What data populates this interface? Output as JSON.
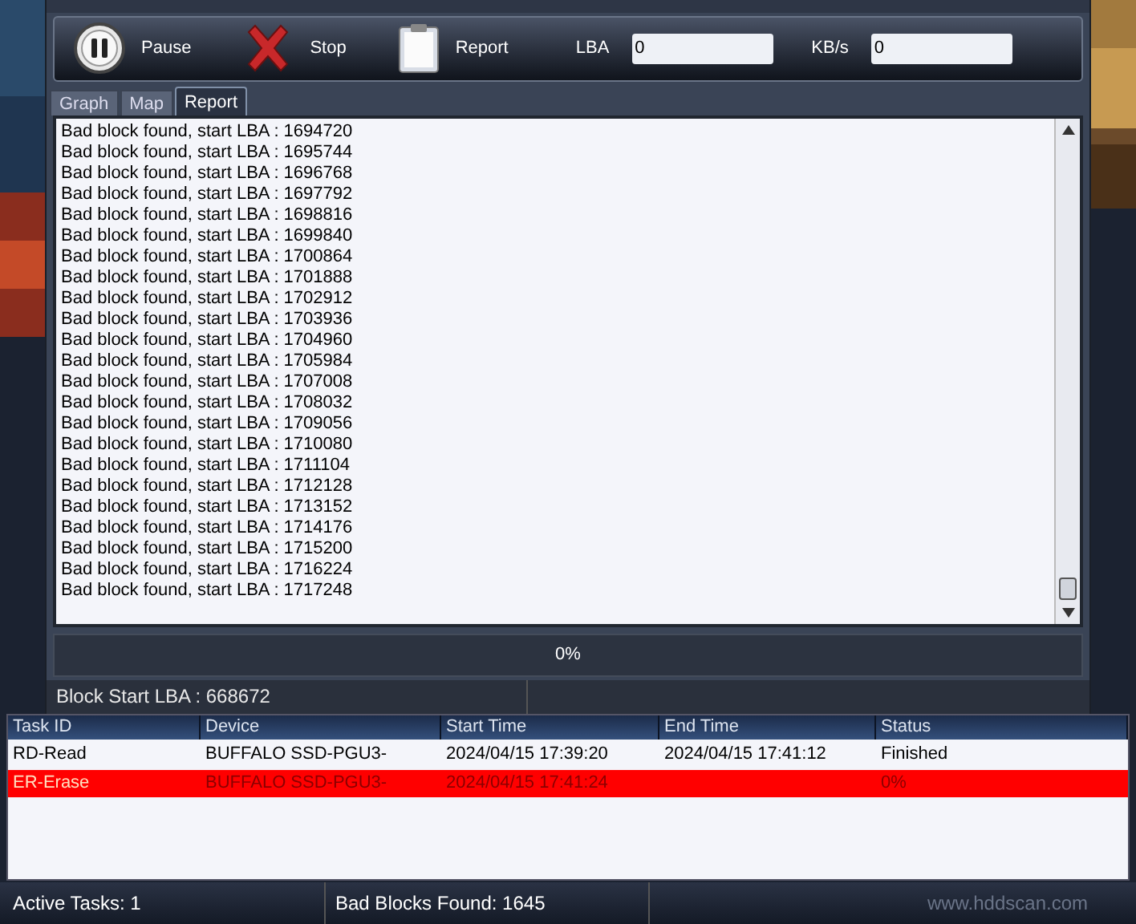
{
  "toolbar": {
    "buttons": [
      {
        "kind": "pause",
        "label": "Pause"
      },
      {
        "kind": "stop",
        "label": "Stop"
      },
      {
        "kind": "report",
        "label": "Report"
      }
    ],
    "fields": [
      {
        "label": "LBA",
        "value": "0"
      },
      {
        "label": "KB/s",
        "value": "0"
      }
    ]
  },
  "tabs": [
    {
      "label": "Graph",
      "selected": false
    },
    {
      "label": "Map",
      "selected": false
    },
    {
      "label": "Report",
      "selected": true
    }
  ],
  "report_lines": [
    "Bad block found, start LBA : 1694720",
    "Bad block found, start LBA : 1695744",
    "Bad block found, start LBA : 1696768",
    "Bad block found, start LBA : 1697792",
    "Bad block found, start LBA : 1698816",
    "Bad block found, start LBA : 1699840",
    "Bad block found, start LBA : 1700864",
    "Bad block found, start LBA : 1701888",
    "Bad block found, start LBA : 1702912",
    "Bad block found, start LBA : 1703936",
    "Bad block found, start LBA : 1704960",
    "Bad block found, start LBA : 1705984",
    "Bad block found, start LBA : 1707008",
    "Bad block found, start LBA : 1708032",
    "Bad block found, start LBA : 1709056",
    "Bad block found, start LBA : 1710080",
    "Bad block found, start LBA : 1711104",
    "Bad block found, start LBA : 1712128",
    "Bad block found, start LBA : 1713152",
    "Bad block found, start LBA : 1714176",
    "Bad block found, start LBA : 1715200",
    "Bad block found, start LBA : 1716224",
    "Bad block found, start LBA : 1717248"
  ],
  "progress": {
    "label": "0%",
    "level": 0
  },
  "dialog_status": "Block Start LBA : 668672",
  "table": {
    "columns": [
      "Task ID",
      "Device",
      "Start Time",
      "End Time",
      "Status"
    ],
    "rows": [
      {
        "cells": [
          "RD-Read",
          "BUFFALO SSD-PGU3-",
          "2024/04/15 17:39:20",
          "2024/04/15 17:41:12",
          "Finished"
        ],
        "selected": false
      },
      {
        "cells": [
          "ER-Erase",
          "BUFFALO SSD-PGU3-",
          "2024/04/15 17:41:24",
          "",
          "0%"
        ],
        "selected": true
      }
    ]
  },
  "status_bar": [
    "Active Tasks: 1",
    "Bad Blocks Found: 1645",
    "www.hddscan.com"
  ]
}
